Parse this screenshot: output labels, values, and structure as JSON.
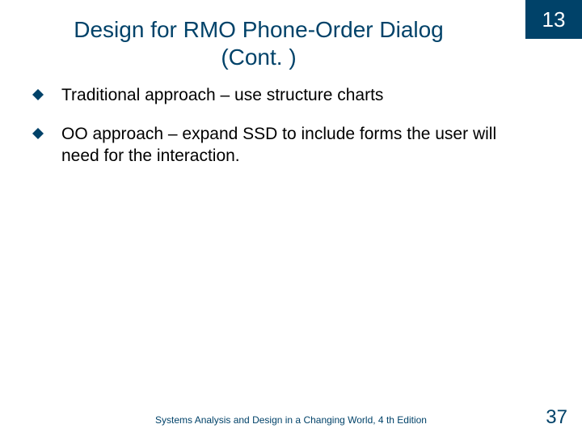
{
  "chapter_number": "13",
  "title_line1": "Design for RMO Phone-Order Dialog",
  "title_line2": "(Cont. )",
  "bullets": {
    "item0": "Traditional approach – use structure charts",
    "item1": "OO approach – expand SSD to include forms the user will need for the interaction."
  },
  "footer_text": "Systems Analysis and Design in a Changing World, 4 th Edition",
  "page_number": "37"
}
